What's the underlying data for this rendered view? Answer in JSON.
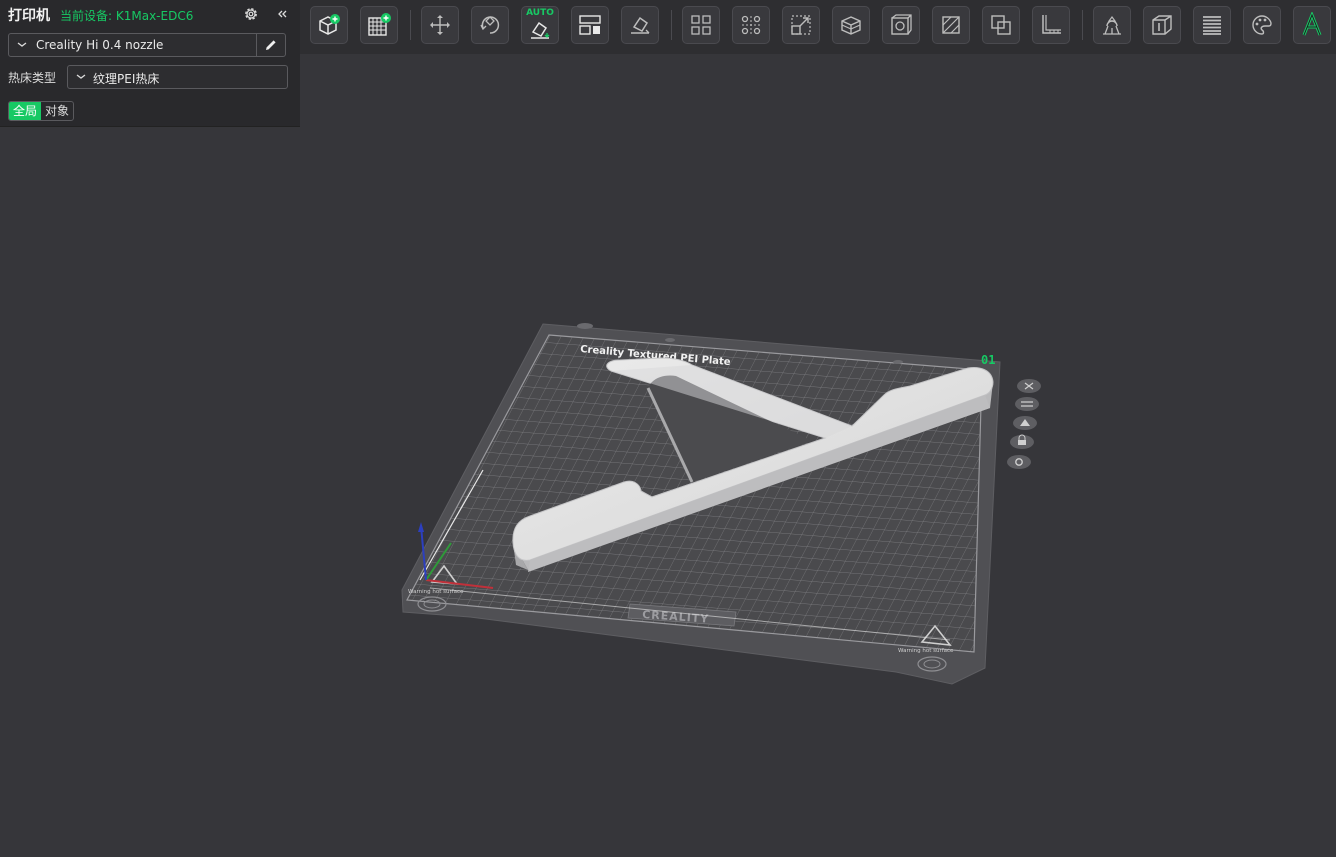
{
  "panel": {
    "title": "打印机",
    "device": "当前设备: K1Max-EDC6",
    "nozzle": "Creality Hi 0.4 nozzle",
    "bed_label": "热床类型",
    "bed_value": "纹理PEI热床",
    "tabs": [
      "全局",
      "对象"
    ]
  },
  "toolbar": {
    "auto_label": "AUTO",
    "buttons": [
      "add-object",
      "add-plate",
      "move",
      "rotate",
      "auto-orient",
      "arrange",
      "lay-on-face",
      "split",
      "cut",
      "scale",
      "hollow",
      "drill",
      "mirror",
      "boolean",
      "measure",
      "support",
      "seam",
      "layer",
      "paint",
      "text"
    ]
  },
  "plate": {
    "label": "Creality Textured PEI Plate",
    "number": "01",
    "brand": "CREALITY",
    "warning": "Warning hot surface"
  },
  "colors": {
    "accent": "#17c964",
    "background": "#36363a",
    "panel": "#29292c"
  }
}
